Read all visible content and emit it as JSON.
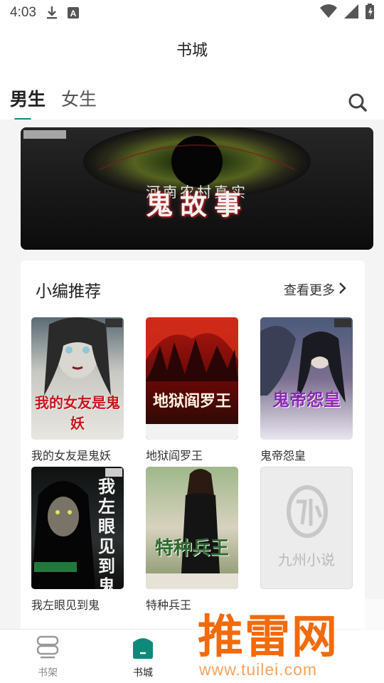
{
  "status_bar": {
    "time": "4:03"
  },
  "header": {
    "title": "书城"
  },
  "tabs": [
    {
      "label": "男生",
      "active": true
    },
    {
      "label": "女生",
      "active": false
    }
  ],
  "banner": {
    "title_text": "鬼故事",
    "top_text": "河南农村真实"
  },
  "recommend": {
    "title": "小编推荐",
    "more_label": "查看更多",
    "books": [
      {
        "name": "我的女友是鬼妖",
        "cover_text": "我的女友是鬼妖"
      },
      {
        "name": "地狱阎罗王",
        "cover_text": "地狱阎罗王"
      },
      {
        "name": "鬼帝怨皇",
        "cover_text": "鬼帝怨皇"
      },
      {
        "name": "我左眼见到鬼",
        "cover_text": "我左眼见到鬼"
      },
      {
        "name": "特种兵王",
        "cover_text": "特种兵王"
      },
      {
        "name": "",
        "cover_text": "九州小说"
      }
    ]
  },
  "bottom_nav": [
    {
      "label": "书架",
      "active": false
    },
    {
      "label": "书城",
      "active": true
    }
  ],
  "watermark": {
    "brand": "推雷网",
    "url": "www.tuilei.com"
  },
  "colors": {
    "accent": "#0f8a7a",
    "watermark": "#f26a0a"
  }
}
